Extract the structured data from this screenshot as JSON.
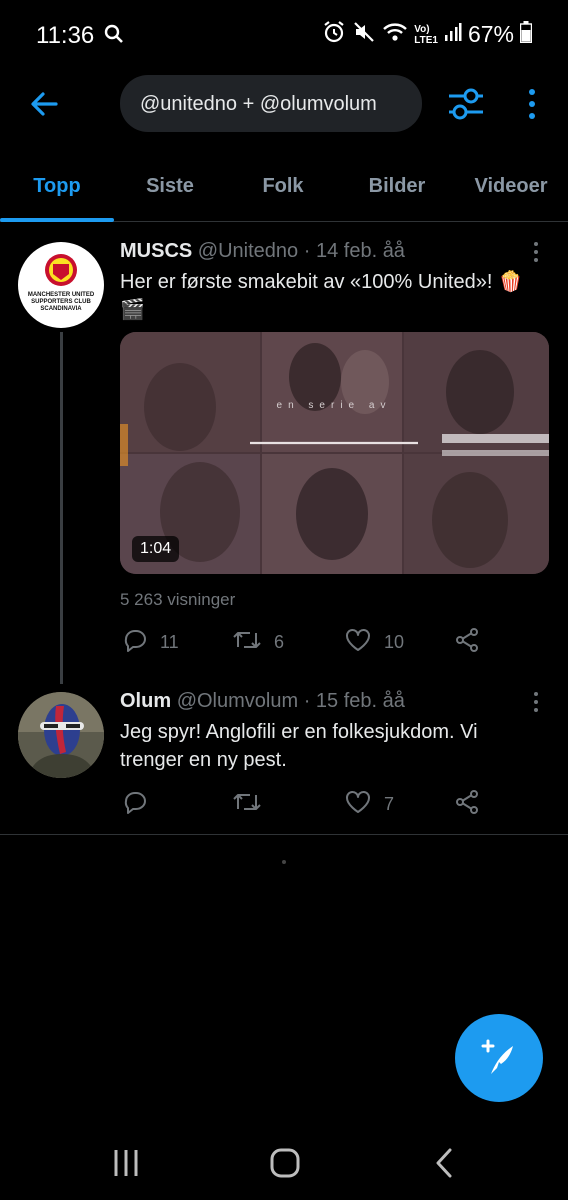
{
  "status_bar": {
    "time": "11:36",
    "battery": "67%",
    "icons": [
      "search-icon",
      "alarm-icon",
      "mute-icon",
      "wifi-icon",
      "volte-icon",
      "signal-icon",
      "battery-icon"
    ],
    "network_label_top": "Vo)",
    "network_label_bottom": "LTE1"
  },
  "header": {
    "search_query": "@unitedno + @olumvolum",
    "back_icon": "arrow-left-icon",
    "filter_icon": "sliders-icon",
    "more_icon": "more-vertical-icon"
  },
  "tabs": [
    {
      "label": "Topp",
      "active": true
    },
    {
      "label": "Siste",
      "active": false
    },
    {
      "label": "Folk",
      "active": false
    },
    {
      "label": "Bilder",
      "active": false
    },
    {
      "label": "Videoer",
      "active": false
    }
  ],
  "tweets": [
    {
      "name": "MUSCS",
      "handle": "@Unitedno",
      "separator": "·",
      "date": "14 feb. åå",
      "text": "Her er første smakebit av «100% United»! 🍿🎬",
      "avatar_text": [
        "MANCHESTER UNITED",
        "SUPPORTERS CLUB",
        "SCANDINAVIA"
      ],
      "media": {
        "overlay_text": "en serie av",
        "duration": "1:04"
      },
      "views": "5 263 visninger",
      "actions": {
        "replies": "11",
        "retweets": "6",
        "likes": "10"
      }
    },
    {
      "name": "Olum",
      "handle": "@Olumvolum",
      "separator": "·",
      "date": "15 feb. åå",
      "text": "Jeg spyr! Anglofili er en folkesjukdom. Vi trenger en ny pest.",
      "actions": {
        "replies": "",
        "retweets": "",
        "likes": "7"
      }
    }
  ],
  "fab": {
    "icon": "compose-tweet-icon"
  },
  "nav": {
    "icons": [
      "recent-apps-icon",
      "home-icon",
      "back-icon"
    ]
  },
  "colors": {
    "accent": "#1d9bf0",
    "background": "#000000",
    "muted": "#71767b"
  }
}
